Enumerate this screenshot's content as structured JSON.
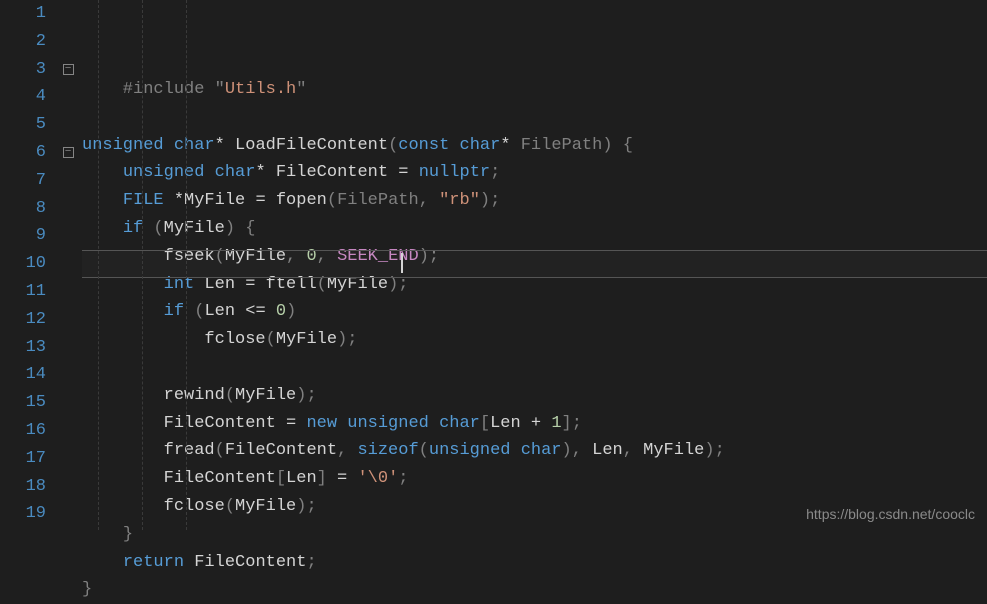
{
  "watermark": "https://blog.csdn.net/cooclc",
  "fold_symbol": "−",
  "lines": [
    {
      "num": "1",
      "fold": "",
      "tokens": [
        [
          "pp",
          "    #include "
        ],
        [
          "pp",
          "\""
        ],
        [
          "str",
          "Utils.h"
        ],
        [
          "pp",
          "\""
        ]
      ]
    },
    {
      "num": "2",
      "fold": "",
      "tokens": []
    },
    {
      "num": "3",
      "fold": "box",
      "tokens": [
        [
          "kw",
          "unsigned"
        ],
        [
          "txt",
          " "
        ],
        [
          "kw",
          "char"
        ],
        [
          "ptr",
          "*"
        ],
        [
          "txt",
          " "
        ],
        [
          "fn",
          "LoadFileContent"
        ],
        [
          "dim",
          "("
        ],
        [
          "kw",
          "const"
        ],
        [
          "txt",
          " "
        ],
        [
          "kw",
          "char"
        ],
        [
          "ptr",
          "*"
        ],
        [
          "txt",
          " "
        ],
        [
          "param",
          "FilePath"
        ],
        [
          "dim",
          ")"
        ],
        [
          "txt",
          " "
        ],
        [
          "dim",
          "{"
        ]
      ]
    },
    {
      "num": "4",
      "fold": "",
      "tokens": [
        [
          "txt",
          "    "
        ],
        [
          "kw",
          "unsigned"
        ],
        [
          "txt",
          " "
        ],
        [
          "kw",
          "char"
        ],
        [
          "ptr",
          "*"
        ],
        [
          "txt",
          " FileContent = "
        ],
        [
          "kw",
          "nullptr"
        ],
        [
          "dim",
          ";"
        ]
      ]
    },
    {
      "num": "5",
      "fold": "",
      "tokens": [
        [
          "txt",
          "    "
        ],
        [
          "kw",
          "FILE"
        ],
        [
          "txt",
          " "
        ],
        [
          "ptr",
          "*"
        ],
        [
          "txt",
          "MyFile = fopen"
        ],
        [
          "dim",
          "("
        ],
        [
          "param",
          "FilePath"
        ],
        [
          "dim",
          ","
        ],
        [
          "txt",
          " "
        ],
        [
          "str",
          "\"rb\""
        ],
        [
          "dim",
          ")"
        ],
        [
          "dim",
          ";"
        ]
      ]
    },
    {
      "num": "6",
      "fold": "box",
      "tokens": [
        [
          "txt",
          "    "
        ],
        [
          "kw",
          "if"
        ],
        [
          "txt",
          " "
        ],
        [
          "dim",
          "("
        ],
        [
          "txt",
          "MyFile"
        ],
        [
          "dim",
          ")"
        ],
        [
          "txt",
          " "
        ],
        [
          "dim",
          "{"
        ]
      ]
    },
    {
      "num": "7",
      "fold": "",
      "tokens": [
        [
          "txt",
          "        fseek"
        ],
        [
          "dim",
          "("
        ],
        [
          "txt",
          "MyFile"
        ],
        [
          "dim",
          ","
        ],
        [
          "txt",
          " "
        ],
        [
          "num",
          "0"
        ],
        [
          "dim",
          ","
        ],
        [
          "txt",
          " "
        ],
        [
          "const-m",
          "SEEK_END"
        ],
        [
          "dim",
          ")"
        ],
        [
          "dim",
          ";"
        ]
      ]
    },
    {
      "num": "8",
      "fold": "",
      "tokens": [
        [
          "txt",
          "        "
        ],
        [
          "kw",
          "int"
        ],
        [
          "txt",
          " Len = ftell"
        ],
        [
          "dim",
          "("
        ],
        [
          "txt",
          "MyFile"
        ],
        [
          "dim",
          ")"
        ],
        [
          "dim",
          ";"
        ]
      ]
    },
    {
      "num": "9",
      "fold": "",
      "tokens": [
        [
          "txt",
          "        "
        ],
        [
          "kw",
          "if"
        ],
        [
          "txt",
          " "
        ],
        [
          "dim",
          "("
        ],
        [
          "txt",
          "Len <= "
        ],
        [
          "num",
          "0"
        ],
        [
          "dim",
          ")"
        ]
      ]
    },
    {
      "num": "10",
      "fold": "",
      "highlight": true,
      "tokens": [
        [
          "txt",
          "            fclose"
        ],
        [
          "dim",
          "("
        ],
        [
          "txt",
          "MyFile"
        ],
        [
          "dim",
          ")"
        ],
        [
          "dim",
          ";"
        ]
      ]
    },
    {
      "num": "11",
      "fold": "",
      "tokens": []
    },
    {
      "num": "12",
      "fold": "",
      "tokens": [
        [
          "txt",
          "        rewind"
        ],
        [
          "dim",
          "("
        ],
        [
          "txt",
          "MyFile"
        ],
        [
          "dim",
          ")"
        ],
        [
          "dim",
          ";"
        ]
      ]
    },
    {
      "num": "13",
      "fold": "",
      "tokens": [
        [
          "txt",
          "        FileContent = "
        ],
        [
          "newkw",
          "new"
        ],
        [
          "txt",
          " "
        ],
        [
          "kw",
          "unsigned"
        ],
        [
          "txt",
          " "
        ],
        [
          "kw",
          "char"
        ],
        [
          "dim",
          "["
        ],
        [
          "txt",
          "Len + "
        ],
        [
          "num",
          "1"
        ],
        [
          "dim",
          "]"
        ],
        [
          "dim",
          ";"
        ]
      ]
    },
    {
      "num": "14",
      "fold": "",
      "tokens": [
        [
          "txt",
          "        fread"
        ],
        [
          "dim",
          "("
        ],
        [
          "txt",
          "FileContent"
        ],
        [
          "dim",
          ","
        ],
        [
          "txt",
          " "
        ],
        [
          "kw",
          "sizeof"
        ],
        [
          "dim",
          "("
        ],
        [
          "kw",
          "unsigned"
        ],
        [
          "txt",
          " "
        ],
        [
          "kw",
          "char"
        ],
        [
          "dim",
          ")"
        ],
        [
          "dim",
          ","
        ],
        [
          "txt",
          " Len"
        ],
        [
          "dim",
          ","
        ],
        [
          "txt",
          " MyFile"
        ],
        [
          "dim",
          ")"
        ],
        [
          "dim",
          ";"
        ]
      ]
    },
    {
      "num": "15",
      "fold": "",
      "tokens": [
        [
          "txt",
          "        FileContent"
        ],
        [
          "dim",
          "["
        ],
        [
          "txt",
          "Len"
        ],
        [
          "dim",
          "]"
        ],
        [
          "txt",
          " = "
        ],
        [
          "str",
          "'\\0'"
        ],
        [
          "dim",
          ";"
        ]
      ]
    },
    {
      "num": "16",
      "fold": "",
      "tokens": [
        [
          "txt",
          "        fclose"
        ],
        [
          "dim",
          "("
        ],
        [
          "txt",
          "MyFile"
        ],
        [
          "dim",
          ")"
        ],
        [
          "dim",
          ";"
        ]
      ]
    },
    {
      "num": "17",
      "fold": "",
      "tokens": [
        [
          "txt",
          "    "
        ],
        [
          "dim",
          "}"
        ]
      ]
    },
    {
      "num": "18",
      "fold": "",
      "tokens": [
        [
          "txt",
          "    "
        ],
        [
          "kw",
          "return"
        ],
        [
          "txt",
          " FileContent"
        ],
        [
          "dim",
          ";"
        ]
      ]
    },
    {
      "num": "19",
      "fold": "",
      "tokens": [
        [
          "dim",
          "}"
        ]
      ]
    }
  ],
  "guides": [
    16,
    60,
    104
  ]
}
